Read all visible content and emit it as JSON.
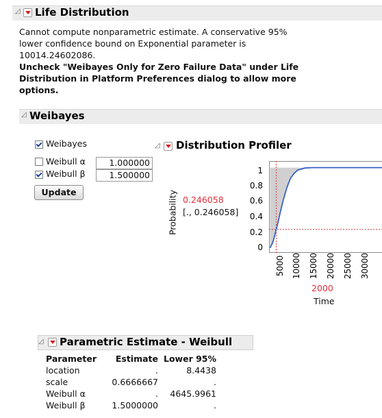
{
  "life_distribution": {
    "title": "Life Distribution",
    "message_lines": [
      "Cannot compute nonparametric estimate. A conservative 95%",
      "lower confidence bound on Exponential parameter is",
      "10014.24602086."
    ],
    "bold_lines": [
      "Uncheck \"Weibayes Only for Zero Failure Data\" under Life",
      "Distribution in Platform Preferences dialog to allow more",
      "options."
    ]
  },
  "weibayes": {
    "title": "Weibayes",
    "checkbox_label": "Weibayes",
    "checkbox_checked": true,
    "alpha": {
      "label": "Weibull α",
      "checked": false,
      "value": "1.000000"
    },
    "beta": {
      "label": "Weibull β",
      "checked": true,
      "value": "1.500000"
    },
    "update_label": "Update"
  },
  "profiler": {
    "title": "Distribution Profiler",
    "y_label": "Probability",
    "y_value": "0.246058",
    "y_interval": "[., 0.246058]",
    "x_value": "2000",
    "x_label": "Time",
    "colors": {
      "curve": "#3a62c4",
      "crosshair": "#e0303a",
      "band": "#c8c8c8",
      "value_text": "#e0303a"
    }
  },
  "chart_data": {
    "type": "line",
    "xlabel": "Time",
    "ylabel": "Probability",
    "x_ticks": [
      "5000",
      "10000",
      "15000",
      "20000",
      "25000",
      "30000"
    ],
    "y_ticks": [
      "0",
      "0.2",
      "0.4",
      "0.6",
      "0.8",
      "1"
    ],
    "xlim": [
      0,
      31500
    ],
    "ylim": [
      -0.04,
      1.08
    ],
    "series": [
      {
        "x": [
          300,
          600,
          1000,
          1500,
          2000,
          2500,
          3000,
          3500,
          4000,
          5000,
          6000,
          7000,
          8000,
          10000,
          12000,
          15000,
          20000,
          25000,
          30000,
          31500
        ],
        "y": [
          0.02,
          0.05,
          0.08,
          0.16,
          0.246,
          0.33,
          0.43,
          0.52,
          0.61,
          0.76,
          0.87,
          0.93,
          0.97,
          0.995,
          1.0,
          1.0,
          1.0,
          1.0,
          1.0,
          1.0
        ]
      }
    ],
    "crosshair": {
      "x": 2000,
      "y": 0.246058
    }
  },
  "parametric": {
    "title": "Parametric Estimate - Weibull",
    "headers": [
      "Parameter",
      "Estimate",
      "Lower 95%"
    ],
    "rows": [
      [
        "location",
        ".",
        "8.4438"
      ],
      [
        "scale",
        "0.6666667",
        "."
      ],
      [
        "Weibull α",
        ".",
        "4645.9961"
      ],
      [
        "Weibull β",
        "1.5000000",
        "."
      ]
    ]
  }
}
